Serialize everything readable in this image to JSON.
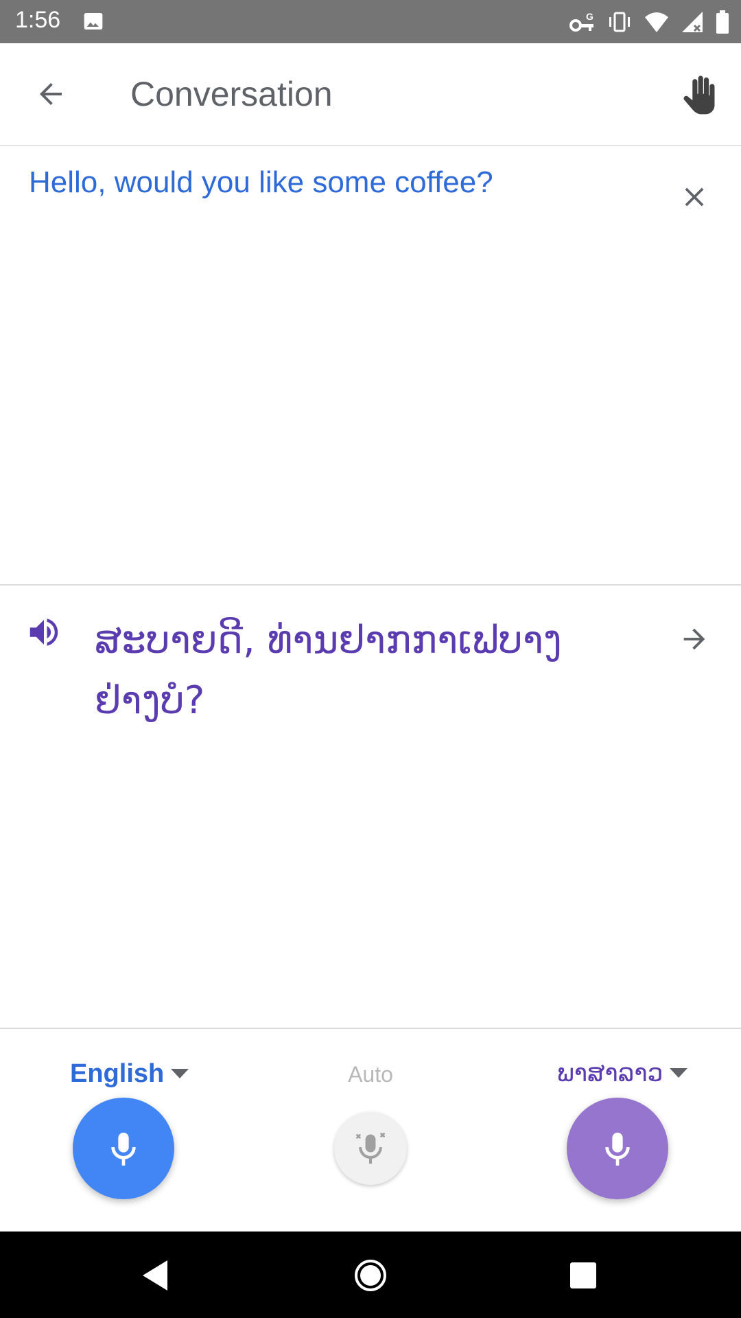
{
  "status_bar": {
    "time": "1:56",
    "icons": [
      "image-icon",
      "vpn-key-icon",
      "vibrate-icon",
      "wifi-icon",
      "signal-icon",
      "battery-icon"
    ]
  },
  "app_bar": {
    "title": "Conversation",
    "back_icon": "arrow-back-icon",
    "hand_icon": "hand-icon"
  },
  "source": {
    "text": "Hello, would you like some coffee?",
    "color": "#2e6bd9"
  },
  "target": {
    "text": "ສະບາຍດີ, ທ່ານຢາກກາເຟບາງຢ່າງບໍ?",
    "color": "#5b3bb0"
  },
  "languages": {
    "left_label": "English",
    "auto_label": "Auto",
    "right_label": "ພາສາລາວ"
  },
  "colors": {
    "left_mic": "#4285f4",
    "right_mic": "#9575cd",
    "status_bar": "#757575"
  }
}
